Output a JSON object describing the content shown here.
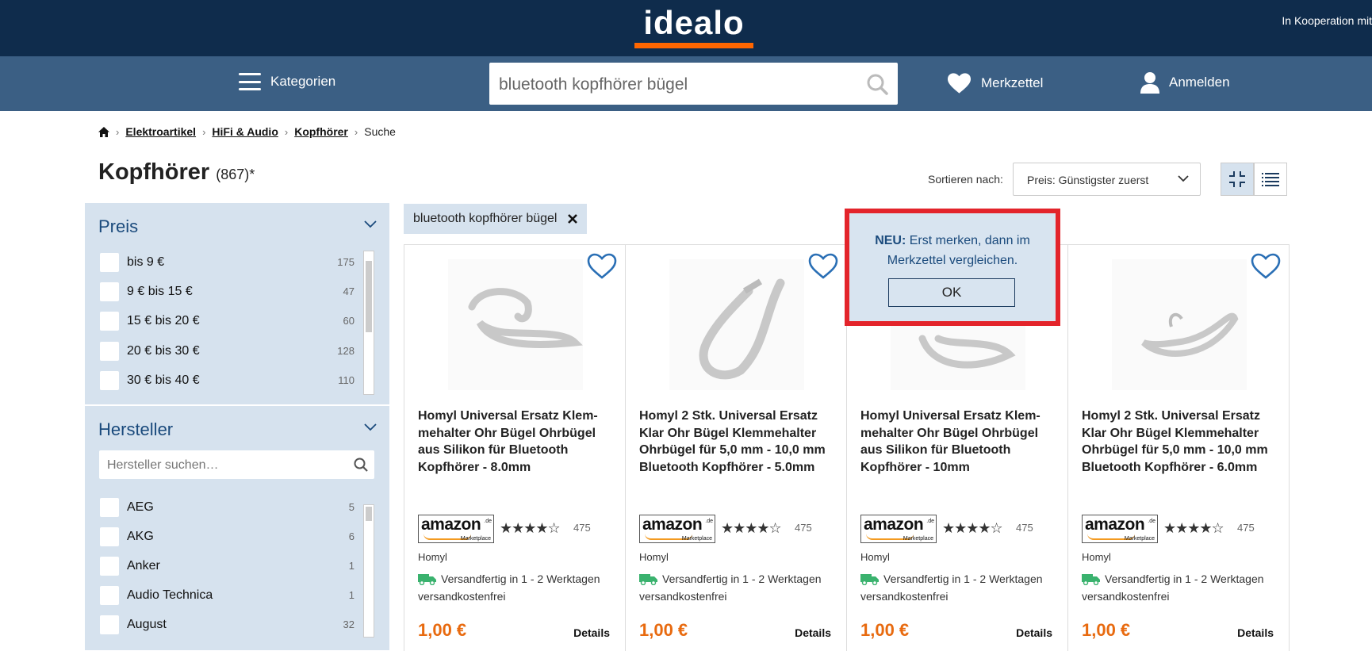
{
  "header": {
    "logo_text": "idealo",
    "cooperation_text": "In Kooperation mit",
    "categories_label": "Kategorien",
    "search_value": "bluetooth kopfhörer bügel",
    "wishlist_label": "Merkzettel",
    "login_label": "Anmelden"
  },
  "breadcrumb": {
    "items": [
      "Elektroartikel",
      "HiFi & Audio",
      "Kopfhörer"
    ],
    "current": "Suche"
  },
  "page": {
    "title": "Kopfhörer",
    "count": "(867)*"
  },
  "sort": {
    "label": "Sortieren nach:",
    "selected": "Preis: Günstigster zuerst"
  },
  "filters": {
    "price": {
      "title": "Preis",
      "options": [
        {
          "label": "bis 9 €",
          "count": "175"
        },
        {
          "label": "9 € bis 15 €",
          "count": "47"
        },
        {
          "label": "15 € bis 20 €",
          "count": "60"
        },
        {
          "label": "20 € bis 30 €",
          "count": "128"
        },
        {
          "label": "30 € bis 40 €",
          "count": "110"
        }
      ]
    },
    "manufacturer": {
      "title": "Hersteller",
      "search_placeholder": "Hersteller suchen…",
      "options": [
        {
          "label": "AEG",
          "count": "5"
        },
        {
          "label": "AKG",
          "count": "6"
        },
        {
          "label": "Anker",
          "count": "1"
        },
        {
          "label": "Audio Technica",
          "count": "1"
        },
        {
          "label": "August",
          "count": "32"
        }
      ]
    }
  },
  "active_filter": {
    "label": "bluetooth kopfhörer bügel"
  },
  "products": [
    {
      "title": "Homyl Universal Ersatz Klem-mehalter Ohr Bügel Ohrbügel aus Silikon für Bluetooth Kopfhörer - 8.0mm",
      "rating_count": "475",
      "brand": "Homyl",
      "shipping": "Versandfertig in 1 - 2 Werktagen",
      "shipping_cost": "versandkostenfrei",
      "price": "1,00 €",
      "details": "Details"
    },
    {
      "title": "Homyl 2 Stk. Universal Ersatz Klar Ohr Bügel Klemmehalter Ohrbügel für 5,0 mm - 10,0 mm Bluetooth Kopfhörer - 5.0mm",
      "rating_count": "475",
      "brand": "Homyl",
      "shipping": "Versandfertig in 1 - 2 Werktagen",
      "shipping_cost": "versandkostenfrei",
      "price": "1,00 €",
      "details": "Details"
    },
    {
      "title": "Homyl Universal Ersatz Klem-mehalter Ohr Bügel Ohrbügel aus Silikon für Bluetooth Kopfhörer - 10mm",
      "rating_count": "475",
      "brand": "Homyl",
      "shipping": "Versandfertig in 1 - 2 Werktagen",
      "shipping_cost": "versandkostenfrei",
      "price": "1,00 €",
      "details": "Details"
    },
    {
      "title": "Homyl 2 Stk. Universal Ersatz Klar Ohr Bügel Klemmehalter Ohrbügel für 5,0 mm - 10,0 mm Bluetooth Kopfhörer - 6.0mm",
      "rating_count": "475",
      "brand": "Homyl",
      "shipping": "Versandfertig in 1 - 2 Werktagen",
      "shipping_cost": "versandkostenfrei",
      "price": "1,00 €",
      "details": "Details"
    }
  ],
  "popup": {
    "bold": "NEU:",
    "text": "Erst merken, dann im Merkzettel vergleichen.",
    "ok_label": "OK"
  },
  "marketplace": {
    "name": "amazon",
    "suffix": ".de",
    "sub": "Marketplace"
  },
  "colors": {
    "header": "#0f2c4c",
    "nav": "#3b5f84",
    "accent": "#ff6600",
    "price": "#e86a0f",
    "filter_bg": "#d6e2ee",
    "popup_border": "#e3242b",
    "link_blue": "#1a4a7c"
  }
}
